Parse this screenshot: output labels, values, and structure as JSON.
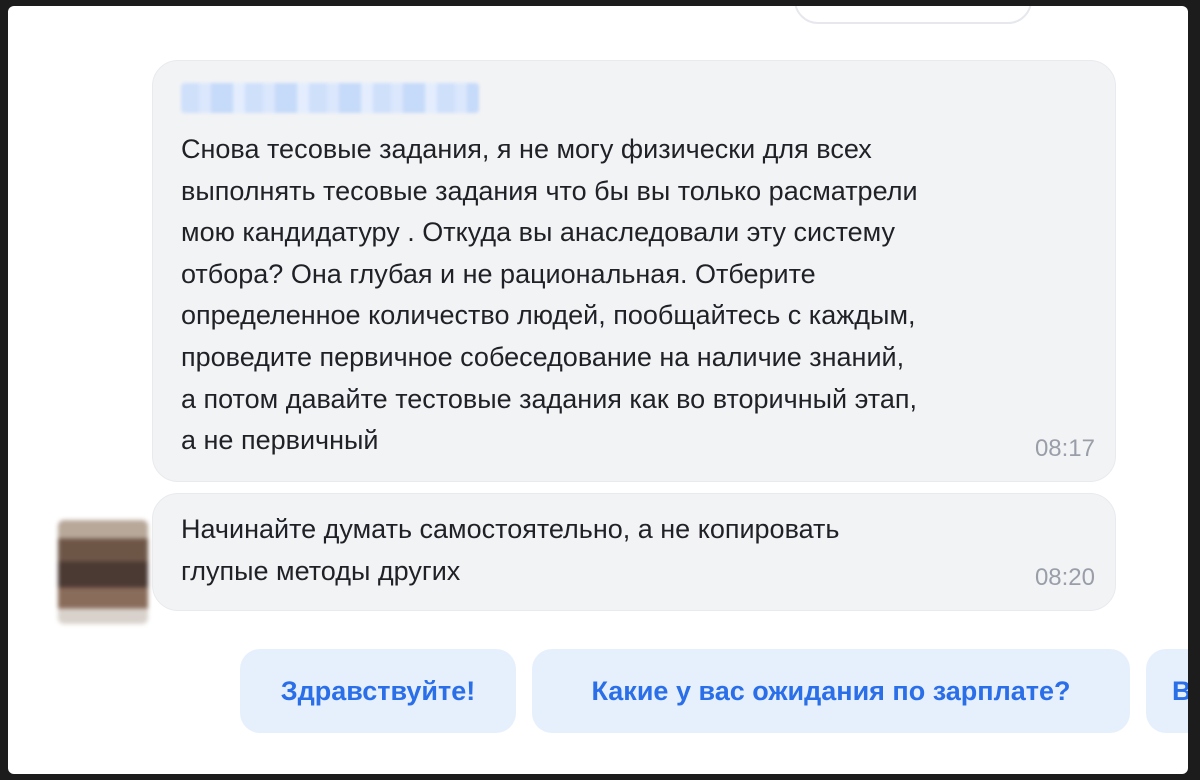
{
  "messages": [
    {
      "sender": "",
      "text": "Снова тесовые задания, я не могу физически для всех\nвыполнять тесовые задания что бы вы только расматрели\nмою кандидатуру . Откуда вы анаследовали эту систему\nотбора? Она глубая и не рациональная. Отберите\nопределенное количество людей, пообщайтесь с каждым,\nпроведите первичное собеседование на наличие знаний,\nа потом давайте тестовые задания как во вторичный этап,\nа не первичный",
      "time": "08:17"
    },
    {
      "text": "Начинайте думать самостоятельно, а не копировать\nглупые методы других",
      "time": "08:20"
    }
  ],
  "quick_replies": [
    "Здравствуйте!",
    "Какие у вас ожидания по зарплате?",
    "В"
  ],
  "colors": {
    "bubble_bg": "#f2f3f5",
    "chip_bg": "#e6f0fd",
    "chip_text": "#2a6ee8",
    "time_text": "#9a9ea8"
  }
}
